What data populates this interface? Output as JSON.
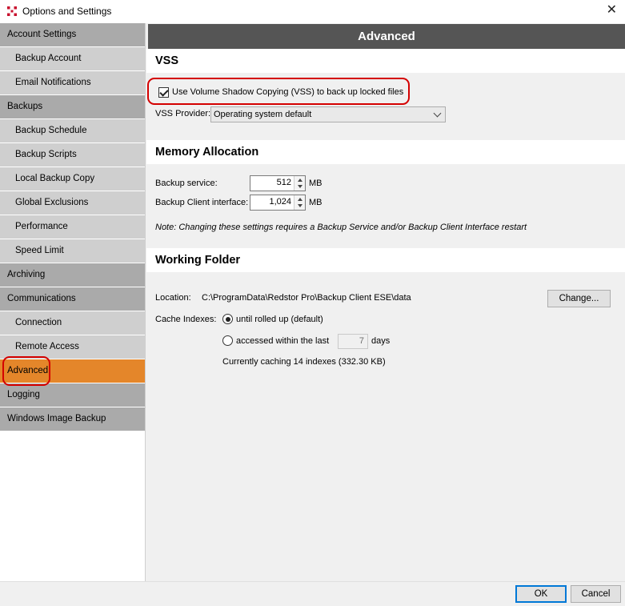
{
  "window": {
    "title": "Options and Settings",
    "close_glyph": "✕",
    "app_icon": "redstor-logo-icon",
    "accent": "#e4862a"
  },
  "sidebar": {
    "items": [
      {
        "label": "Account Settings",
        "level": 0
      },
      {
        "label": "Backup Account",
        "level": 1
      },
      {
        "label": "Email Notifications",
        "level": 1
      },
      {
        "label": "Backups",
        "level": 0
      },
      {
        "label": "Backup Schedule",
        "level": 1
      },
      {
        "label": "Backup Scripts",
        "level": 1
      },
      {
        "label": "Local Backup Copy",
        "level": 1
      },
      {
        "label": "Global Exclusions",
        "level": 1
      },
      {
        "label": "Performance",
        "level": 1
      },
      {
        "label": "Speed Limit",
        "level": 1
      },
      {
        "label": "Archiving",
        "level": 0
      },
      {
        "label": "Communications",
        "level": 0
      },
      {
        "label": "Connection",
        "level": 1
      },
      {
        "label": "Remote Access",
        "level": 1
      },
      {
        "label": "Advanced",
        "level": 0,
        "selected": true
      },
      {
        "label": "Logging",
        "level": 0
      },
      {
        "label": "Windows Image Backup",
        "level": 0
      }
    ]
  },
  "page": {
    "header": "Advanced"
  },
  "vss": {
    "heading": "VSS",
    "checkbox_label": "Use Volume Shadow Copying (VSS) to back up locked files",
    "checked": true,
    "provider_label": "VSS Provider:",
    "provider_value": "Operating system default"
  },
  "memory": {
    "heading": "Memory Allocation",
    "service_label": "Backup service:",
    "service_value": "512",
    "client_label": "Backup Client interface:",
    "client_value": "1,024",
    "unit": "MB",
    "note": "Note: Changing these settings requires a Backup Service and/or Backup Client Interface restart"
  },
  "working_folder": {
    "heading": "Working Folder",
    "location_label": "Location:",
    "location_value": "C:\\ProgramData\\Redstor Pro\\Backup Client ESE\\data",
    "change_button": "Change...",
    "cache_label": "Cache Indexes:",
    "option_rolled_up": "until rolled up (default)",
    "option_accessed": "accessed within the last",
    "days_value": "7",
    "days_label": "days",
    "status": "Currently caching 14 indexes (332.30 KB)"
  },
  "footer": {
    "ok": "OK",
    "cancel": "Cancel"
  }
}
